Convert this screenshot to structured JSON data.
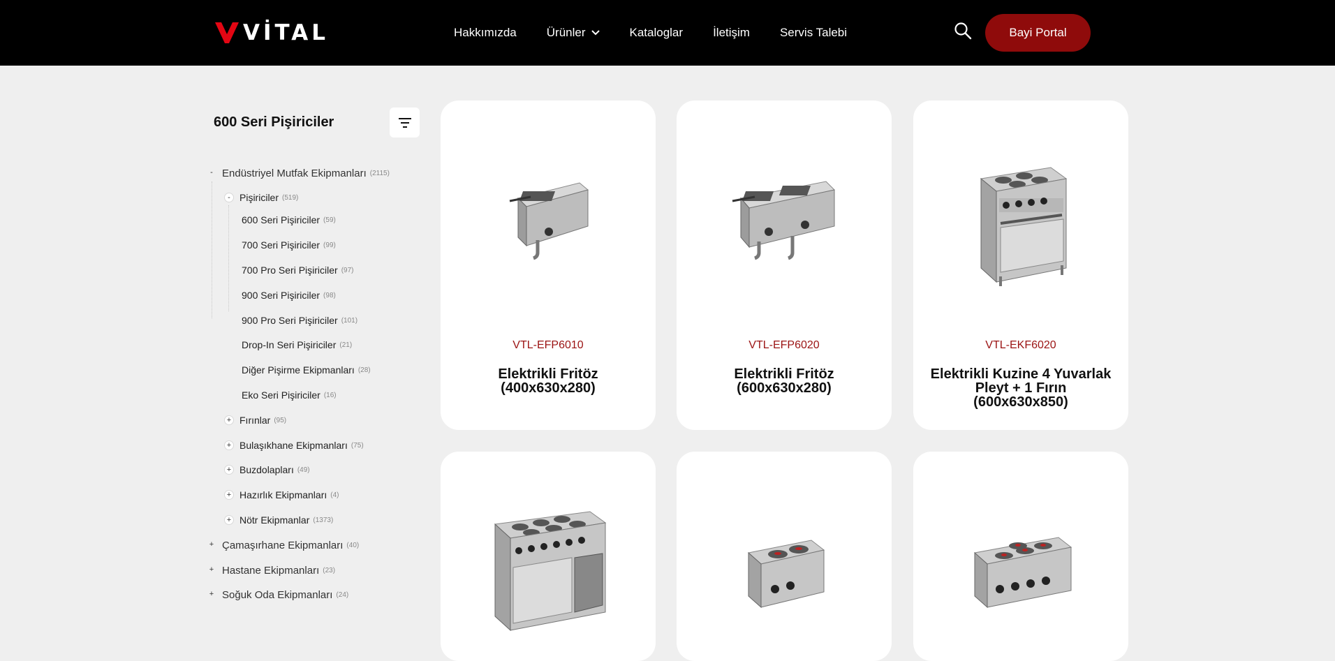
{
  "header": {
    "brand": "VİTAL",
    "nav": [
      {
        "label": "Hakkımızda"
      },
      {
        "label": "Ürünler",
        "has_dropdown": true
      },
      {
        "label": "Kataloglar"
      },
      {
        "label": "İletişim"
      },
      {
        "label": "Servis Talebi"
      }
    ],
    "dealer_button": "Bayi Portal",
    "icons": {
      "search": "search-icon",
      "dropdown": "chevron-down-icon"
    }
  },
  "sidebar": {
    "title": "600 Seri Pişiriciler",
    "filter_icon": "filter-icon",
    "tree": [
      {
        "toggle": "-",
        "label": "Endüstriyel Mutfak Ekipmanları",
        "count": "(2115)"
      },
      {
        "toggle": "-",
        "label": "Pişiriciler",
        "count": "(519)"
      },
      {
        "label": "600 Seri Pişiriciler",
        "count": "(59)"
      },
      {
        "label": "700 Seri Pişiriciler",
        "count": "(99)"
      },
      {
        "label": "700 Pro Seri Pişiriciler",
        "count": "(97)"
      },
      {
        "label": "900 Seri Pişiriciler",
        "count": "(98)"
      },
      {
        "label": "900 Pro Seri Pişiriciler",
        "count": "(101)"
      },
      {
        "label": "Drop-In Seri Pişiriciler",
        "count": "(21)"
      },
      {
        "label": "Diğer Pişirme Ekipmanları",
        "count": "(28)"
      },
      {
        "label": "Eko Seri Pişiriciler",
        "count": "(16)"
      },
      {
        "toggle": "+",
        "label": "Fırınlar",
        "count": "(95)"
      },
      {
        "toggle": "+",
        "label": "Bulaşıkhane Ekipmanları",
        "count": "(75)"
      },
      {
        "toggle": "+",
        "label": "Buzdolapları",
        "count": "(49)"
      },
      {
        "toggle": "+",
        "label": "Hazırlık Ekipmanları",
        "count": "(4)"
      },
      {
        "toggle": "+",
        "label": "Nötr Ekipmanlar",
        "count": "(1373)"
      },
      {
        "toggle": "+",
        "label": "Çamaşırhane Ekipmanları",
        "count": "(40)"
      },
      {
        "toggle": "+",
        "label": "Hastane Ekipmanları",
        "count": "(23)"
      },
      {
        "toggle": "+",
        "label": "Soğuk Oda Ekipmanları",
        "count": "(24)"
      }
    ]
  },
  "products": [
    {
      "sku": "VTL-EFP6010",
      "name": "Elektrikli Fritöz (400x630x280)"
    },
    {
      "sku": "VTL-EFP6020",
      "name": "Elektrikli Fritöz (600x630x280)"
    },
    {
      "sku": "VTL-EKF6020",
      "name": "Elektrikli Kuzine 4 Yuvarlak Pleyt + 1 Fırın (600x630x850)"
    },
    {
      "sku": "",
      "name": ""
    },
    {
      "sku": "",
      "name": ""
    },
    {
      "sku": "",
      "name": ""
    }
  ],
  "colors": {
    "accent": "#8f0b0b",
    "sku": "#9b1313",
    "header_bg": "#000000",
    "page_bg": "#efefef"
  }
}
